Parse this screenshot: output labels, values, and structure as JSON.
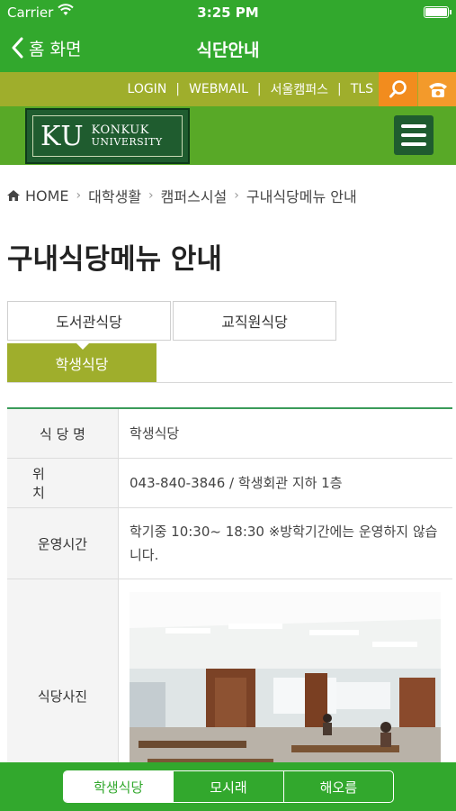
{
  "status": {
    "carrier": "Carrier",
    "time": "3:25 PM"
  },
  "nav": {
    "back_label": "홈 화면",
    "title": "식단안내"
  },
  "utility": {
    "links": [
      "LOGIN",
      "WEBMAIL",
      "서울캠퍼스",
      "TLS"
    ],
    "separator": "|",
    "icons": {
      "search": "search-icon",
      "phone": "phone-icon"
    }
  },
  "logo": {
    "short": "KU",
    "line1": "KONKUK",
    "line2": "UNIVERSITY"
  },
  "breadcrumb": {
    "home": "HOME",
    "items": [
      "대학생활",
      "캠퍼스시설",
      "구내식당메뉴 안내"
    ]
  },
  "page_title": "구내식당메뉴 안내",
  "tabs": [
    {
      "label": "도서관식당"
    },
    {
      "label": "교직원식당"
    },
    {
      "label": "학생식당",
      "active": true
    }
  ],
  "info": {
    "rows": [
      {
        "label": "식 당 명",
        "value": "학생식당"
      },
      {
        "label": "위 치",
        "value": "043-840-3846 / 학생회관 지하 1층"
      },
      {
        "label": "운영시간",
        "value": "학기중 10:30~ 18:30 ※방학기간에는 운영하지 않습니다."
      },
      {
        "label": "식당사진",
        "value": ""
      }
    ]
  },
  "bottom_tabs": [
    {
      "label": "학생식당",
      "active": true
    },
    {
      "label": "모시래"
    },
    {
      "label": "해오름"
    }
  ],
  "colors": {
    "primary_green": "#32a82d",
    "olive": "#9fae2c",
    "orange": "#f28c1e",
    "dark_green": "#1f5c2f"
  }
}
